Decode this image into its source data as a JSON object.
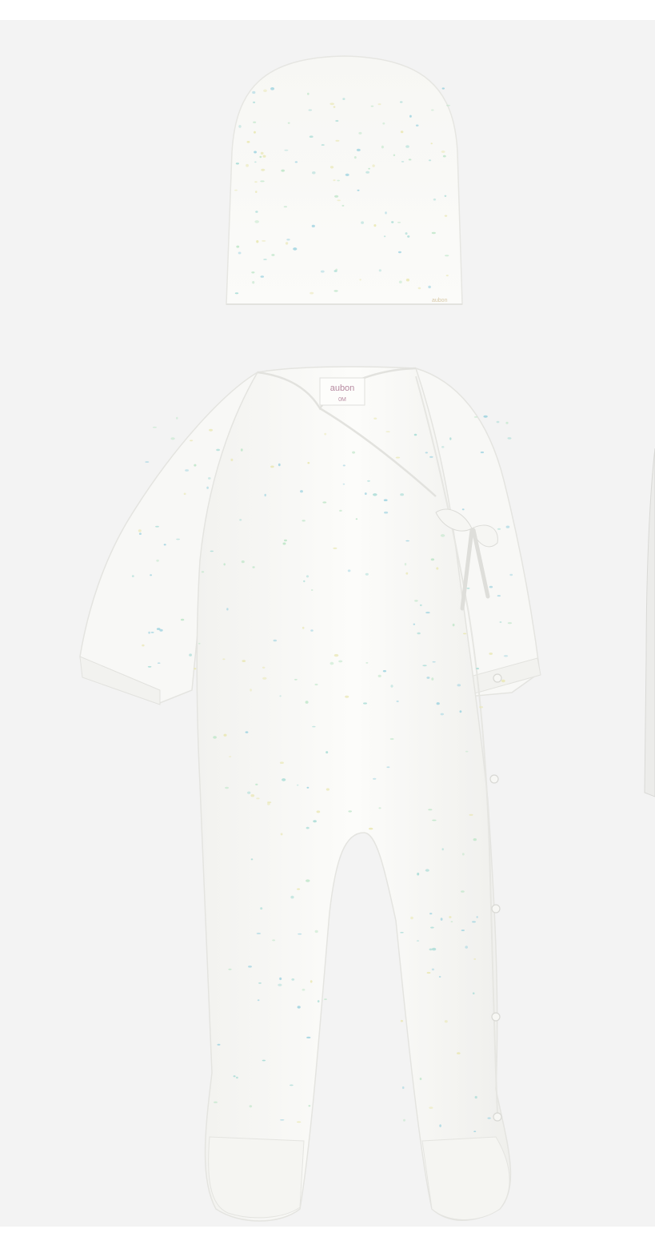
{
  "product_photo": {
    "background_color": "#f3f3f3",
    "garment_color": "#fbfbf9",
    "print_colors": [
      "#a9dcd6",
      "#bfe6c9",
      "#e9e7b3",
      "#9fd3e0"
    ],
    "hat": {
      "label_text": "aubon"
    },
    "romper": {
      "neck_label_brand": "aubon",
      "neck_label_size": "0M"
    }
  }
}
